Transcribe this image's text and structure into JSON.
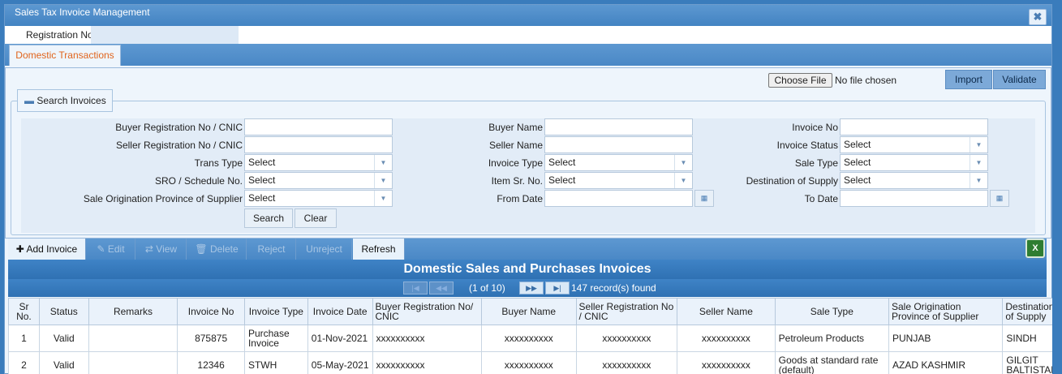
{
  "window": {
    "title": "Sales Tax Invoice Management",
    "close_icon": "close-icon"
  },
  "registration": {
    "label": "Registration No",
    "value": ""
  },
  "tabs": [
    {
      "label": "Domestic Transactions",
      "active": true
    }
  ],
  "file": {
    "choose_label": "Choose File",
    "status": "No file chosen"
  },
  "actions": {
    "import": "Import",
    "validate": "Validate"
  },
  "search": {
    "legend": "Search Invoices",
    "legend_icon": "minus",
    "col1": {
      "buyer_reg_label": "Buyer Registration No / CNIC",
      "seller_reg_label": "Seller Registration No / CNIC",
      "trans_type_label": "Trans Type",
      "trans_type_value": "Select",
      "sro_label": "SRO / Schedule No.",
      "sro_value": "Select",
      "origin_label": "Sale Origination Province of Supplier",
      "origin_value": "Select"
    },
    "col2": {
      "buyer_name_label": "Buyer Name",
      "seller_name_label": "Seller Name",
      "invoice_type_label": "Invoice Type",
      "invoice_type_value": "Select",
      "item_sr_label": "Item Sr. No.",
      "item_sr_value": "Select",
      "from_date_label": "From Date"
    },
    "col3": {
      "invoice_no_label": "Invoice No",
      "invoice_status_label": "Invoice Status",
      "invoice_status_value": "Select",
      "sale_type_label": "Sale Type",
      "sale_type_value": "Select",
      "destination_label": "Destination of Supply",
      "destination_value": "Select",
      "to_date_label": "To Date"
    },
    "search_btn": "Search",
    "clear_btn": "Clear"
  },
  "toolbar": {
    "add": "Add Invoice",
    "edit": "Edit",
    "view": "View",
    "delete": "Delete",
    "reject": "Reject",
    "unreject": "Unreject",
    "refresh": "Refresh",
    "excel_icon": "excel-export-icon"
  },
  "grid": {
    "title": "Domestic Sales and Purchases Invoices",
    "pager_text": "(1 of 10)",
    "records_text": "147 record(s) found",
    "columns": [
      "Sr No.",
      "Status",
      "Remarks",
      "Invoice No",
      "Invoice Type",
      "Invoice Date",
      "Buyer Registration No/ CNIC",
      "Buyer Name",
      "Seller Registration No / CNIC",
      "Seller Name",
      "Sale Type",
      "Sale Origination Province of Supplier",
      "Destination of Supply"
    ],
    "rows": [
      [
        "1",
        "Valid",
        "",
        "875875",
        "Purchase Invoice",
        "01-Nov-2021",
        "xxxxxxxxxx",
        "xxxxxxxxxx",
        "xxxxxxxxxx",
        "xxxxxxxxxx",
        "Petroleum Products",
        "PUNJAB",
        "SINDH"
      ],
      [
        "2",
        "Valid",
        "",
        "12346",
        "STWH",
        "05-May-2021",
        "xxxxxxxxxx",
        "xxxxxxxxxx",
        "xxxxxxxxxx",
        "xxxxxxxxxx",
        "Goods at standard rate (default)",
        "AZAD KASHMIR",
        "GILGIT BALTISTAN"
      ]
    ]
  }
}
